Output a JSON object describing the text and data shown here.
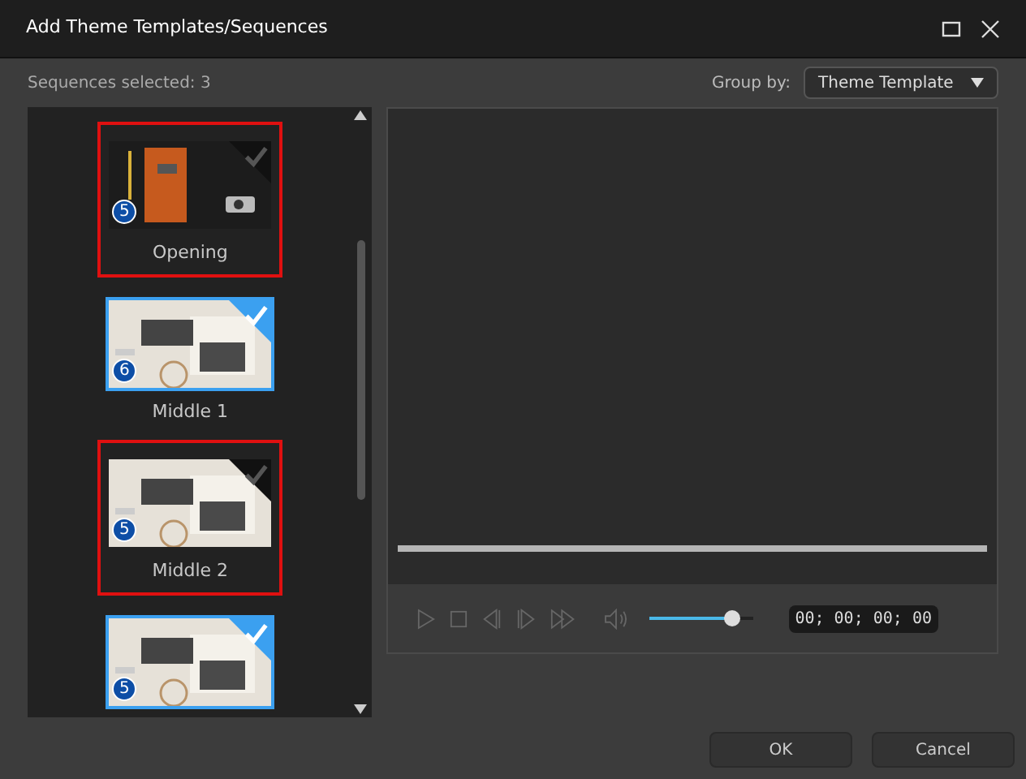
{
  "window": {
    "title": "Add Theme Templates/Sequences"
  },
  "selection_count": "Sequences selected: 3",
  "group_by": {
    "label": "Group by:",
    "value": "Theme Template"
  },
  "templates": [
    {
      "label": "Opening",
      "badge": "5",
      "checked": false,
      "highlighted": true
    },
    {
      "label": "Middle 1",
      "badge": "6",
      "checked": true,
      "highlighted": false
    },
    {
      "label": "Middle 2",
      "badge": "5",
      "checked": false,
      "highlighted": true
    },
    {
      "badge": "5",
      "checked": true,
      "highlighted": false
    }
  ],
  "player": {
    "volume": {
      "level": 0.8
    },
    "timecode": "00; 00; 00; 00"
  },
  "buttons": [
    "OK",
    "Cancel"
  ]
}
